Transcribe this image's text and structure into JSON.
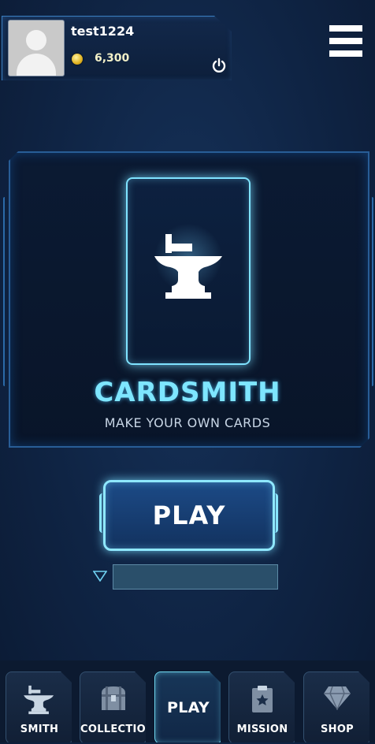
{
  "profile": {
    "username": "test1224",
    "coins": "6,300"
  },
  "main": {
    "title": "CARDSMITH",
    "subtitle": "MAKE YOUR OWN CARDS",
    "play_label": "PLAY"
  },
  "nav": {
    "tabs": [
      {
        "label": "SMITH",
        "icon": "anvil-icon"
      },
      {
        "label": "COLLECTION",
        "icon": "chest-icon"
      },
      {
        "label": "PLAY",
        "icon": "",
        "active": true
      },
      {
        "label": "MISSION",
        "icon": "clipboard-star-icon"
      },
      {
        "label": "SHOP",
        "icon": "diamond-icon"
      }
    ]
  },
  "colors": {
    "accent": "#7ee6ff",
    "background": "#0f2444",
    "coin": "#e0b220"
  }
}
